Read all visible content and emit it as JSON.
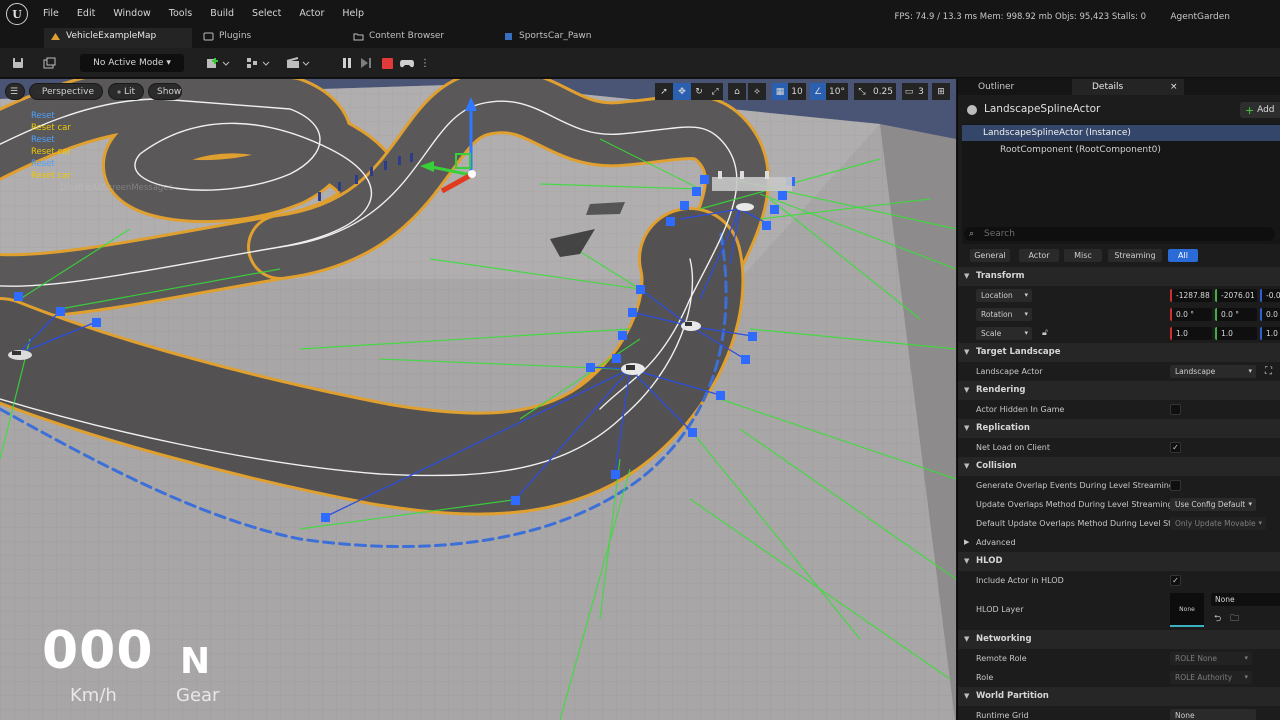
{
  "menu": [
    "File",
    "Edit",
    "Window",
    "Tools",
    "Build",
    "Select",
    "Actor",
    "Help"
  ],
  "stats": {
    "fps_label": "FPS:",
    "fps": "74.9",
    "ms": "/ 13.3 ms",
    "mem_label": "Mem:",
    "mem": "998.92 mb",
    "objs_label": "Objs:",
    "objs": "95,423",
    "stalls_label": "Stalls:",
    "stalls": "0"
  },
  "project": "AgentGarden",
  "tabs": [
    "VehicleExampleMap",
    "Plugins",
    "Content Browser",
    "SportsCar_Pawn"
  ],
  "toolbar": {
    "mode": "No Active Mode"
  },
  "viewport": {
    "perspective": "Perspective",
    "lit": "Lit",
    "show": "Show",
    "grid_size": "10",
    "angle_snap": "10°",
    "scale_snap": "0.25",
    "camera_speed": "3",
    "debug_lines": [
      "Reset",
      "Reset car",
      "Reset",
      "Reset car",
      "Reset",
      "Reset car"
    ],
    "debug_faded": "DisableAllScreenMessages ... ...",
    "hud_speed": "000",
    "hud_speed_unit": "Km/h",
    "hud_gear": "N",
    "hud_gear_label": "Gear"
  },
  "panel": {
    "tabs": [
      "Outliner",
      "Details"
    ],
    "actor_name": "LandscapeSplineActor",
    "add_label": "Add",
    "components": [
      "LandscapeSplineActor (Instance)",
      "RootComponent (RootComponent0)"
    ],
    "search_placeholder": "Search",
    "filters": [
      "General",
      "Actor",
      "Misc",
      "Streaming",
      "All"
    ],
    "transform": {
      "header": "Transform",
      "location_label": "Location",
      "location": [
        "-1287.88",
        "-2076.01",
        "-0.0"
      ],
      "rotation_label": "Rotation",
      "rotation": [
        "0.0 °",
        "0.0 °",
        "0.0 °"
      ],
      "scale_label": "Scale",
      "scale": [
        "1.0",
        "1.0",
        "1.0"
      ]
    },
    "target_landscape": {
      "header": "Target Landscape",
      "label": "Landscape Actor",
      "value": "Landscape"
    },
    "rendering": {
      "header": "Rendering",
      "label": "Actor Hidden In Game"
    },
    "replication": {
      "header": "Replication",
      "label": "Net Load on Client"
    },
    "collision": {
      "header": "Collision",
      "gen_overlap": "Generate Overlap Events During Level Streaming",
      "update_overlaps": "Update Overlaps Method During Level Streaming",
      "update_overlaps_value": "Use Config Default",
      "default_update": "Default Update Overlaps Method During Level Stre...",
      "default_update_value": "Only Update Movable"
    },
    "advanced": "Advanced",
    "hlod": {
      "header": "HLOD",
      "include": "Include Actor in HLOD",
      "layer": "HLOD Layer",
      "thumb": "None",
      "layer_value": "None"
    },
    "networking": {
      "header": "Networking",
      "remote_role": "Remote Role",
      "remote_role_value": "ROLE None",
      "role": "Role",
      "role_value": "ROLE Authority"
    },
    "world_partition": {
      "header": "World Partition",
      "runtime_grid": "Runtime Grid",
      "runtime_grid_value": "None"
    }
  }
}
